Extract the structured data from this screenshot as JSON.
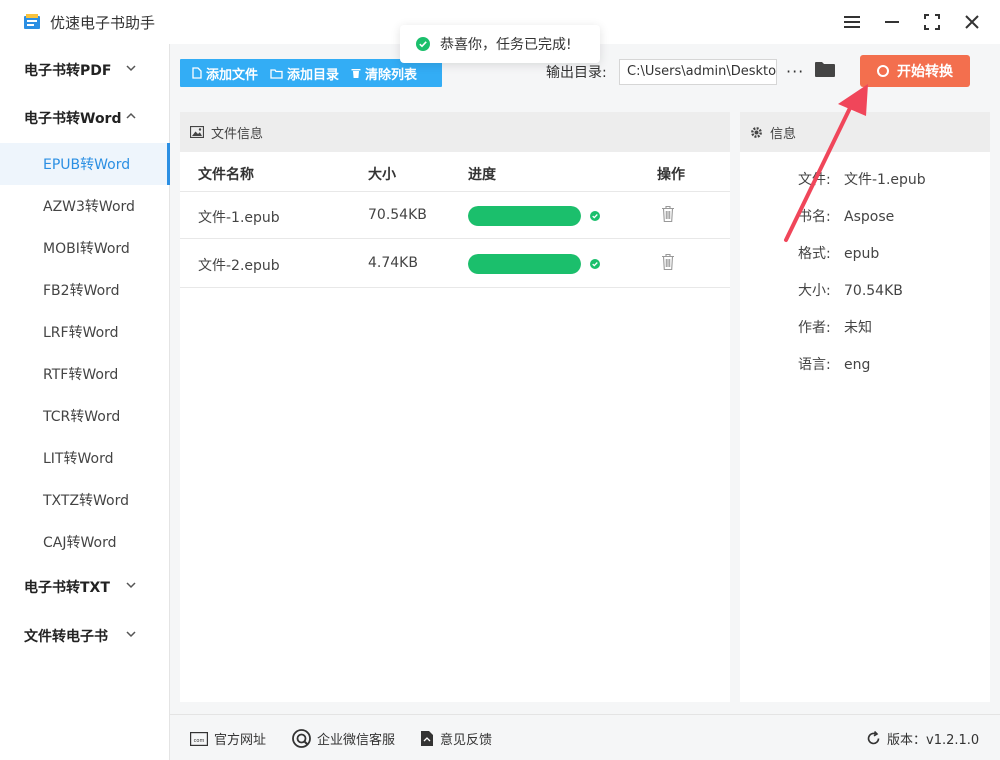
{
  "app": {
    "title": "优速电子书助手"
  },
  "toast": {
    "message": "恭喜你，任务已完成!"
  },
  "sidebar": {
    "groups": [
      {
        "label": "电子书转PDF"
      },
      {
        "label": "电子书转Word"
      },
      {
        "label": "电子书转TXT"
      },
      {
        "label": "文件转电子书"
      }
    ],
    "word_items": [
      {
        "label": "EPUB转Word",
        "active": true
      },
      {
        "label": "AZW3转Word"
      },
      {
        "label": "MOBI转Word"
      },
      {
        "label": "FB2转Word"
      },
      {
        "label": "LRF转Word"
      },
      {
        "label": "RTF转Word"
      },
      {
        "label": "TCR转Word"
      },
      {
        "label": "LIT转Word"
      },
      {
        "label": "TXTZ转Word"
      },
      {
        "label": "CAJ转Word"
      }
    ]
  },
  "toolbar": {
    "add_file": "添加文件",
    "add_folder": "添加目录",
    "clear_list": "清除列表",
    "output_label": "输出目录:",
    "output_path": "C:\\Users\\admin\\Desktop",
    "more": "···",
    "start": "开始转换"
  },
  "file_panel": {
    "title": "文件信息",
    "columns": {
      "name": "文件名称",
      "size": "大小",
      "progress": "进度",
      "action": "操作"
    },
    "rows": [
      {
        "name": "文件-1.epub",
        "size": "70.54KB",
        "progress": 1.0
      },
      {
        "name": "文件-2.epub",
        "size": "4.74KB",
        "progress": 1.0
      }
    ]
  },
  "info_panel": {
    "title": "信息",
    "fields": [
      {
        "key": "文件:",
        "value": "文件-1.epub"
      },
      {
        "key": "书名:",
        "value": "Aspose"
      },
      {
        "key": "格式:",
        "value": "epub"
      },
      {
        "key": "大小:",
        "value": "70.54KB"
      },
      {
        "key": "作者:",
        "value": "未知"
      },
      {
        "key": "语言:",
        "value": "eng"
      }
    ]
  },
  "footer": {
    "website": "官方网址",
    "wechat": "企业微信客服",
    "feedback": "意见反馈",
    "version": "版本：v1.2.1.0"
  },
  "colors": {
    "accent": "#2b8fe3",
    "toolbar": "#33adf5",
    "start_button": "#f36f4e",
    "progress": "#1bbf6c",
    "arrow": "#f0465a"
  }
}
